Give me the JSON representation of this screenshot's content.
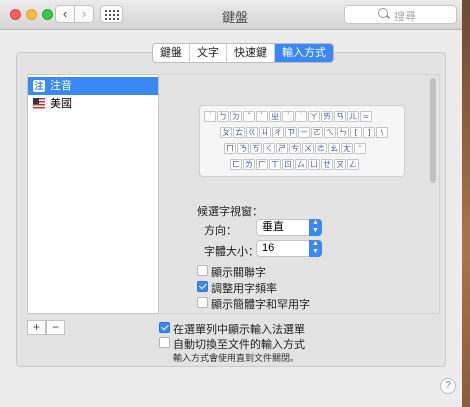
{
  "window": {
    "title": "鍵盤"
  },
  "search": {
    "placeholder": "搜尋"
  },
  "tabs": [
    {
      "label": "鍵盤",
      "active": false
    },
    {
      "label": "文字",
      "active": false
    },
    {
      "label": "快速鍵",
      "active": false
    },
    {
      "label": "輸入方式",
      "active": true
    }
  ],
  "sources": [
    {
      "label": "注音",
      "icon": "zhuyin-badge-icon",
      "icon_text": "注",
      "selected": true
    },
    {
      "label": "美國",
      "icon": "us-flag-icon",
      "selected": false
    }
  ],
  "keyboard_rows": [
    [
      "˙",
      "ㄅ",
      "ㄉ",
      "ˇ",
      "ˋ",
      "ㄓ",
      "ˊ",
      "˙",
      "ㄚ",
      "ㄞ",
      "ㄢ",
      "ㄦ",
      "="
    ],
    [
      "ㄆ",
      "ㄊ",
      "ㄍ",
      "ㄐ",
      "ㄔ",
      "ㄗ",
      "ㄧ",
      "ㄛ",
      "ㄟ",
      "ㄣ",
      "[",
      "]",
      "\\"
    ],
    [
      "ㄇ",
      "ㄋ",
      "ㄎ",
      "ㄑ",
      "ㄕ",
      "ㄘ",
      "ㄨ",
      "ㄜ",
      "ㄠ",
      "ㄤ",
      "'"
    ],
    [
      "ㄈ",
      "ㄌ",
      "ㄏ",
      "ㄒ",
      "ㄖ",
      "ㄙ",
      "ㄩ",
      "ㄝ",
      "ㄡ",
      "ㄥ"
    ]
  ],
  "candidate_window": {
    "heading": "候選字視窗：",
    "orientation_label": "方向：",
    "orientation_value": "垂直",
    "font_size_label": "字體大小：",
    "font_size_value": "16"
  },
  "options": [
    {
      "label": "顯示關聯字",
      "checked": false
    },
    {
      "label": "調整用字頻率",
      "checked": true
    },
    {
      "label": "顯示簡體字和罕用字",
      "checked": false
    }
  ],
  "bottom": {
    "show_menu_label": "在選單列中顯示輸入法選單",
    "show_menu_checked": true,
    "auto_switch_label": "自動切換至文件的輸入方式",
    "auto_switch_checked": false,
    "note": "輸入方式會使用直到文件關閉。"
  },
  "buttons": {
    "add": "+",
    "remove": "−",
    "help": "?"
  },
  "colors": {
    "accent": "#3a88f5"
  }
}
